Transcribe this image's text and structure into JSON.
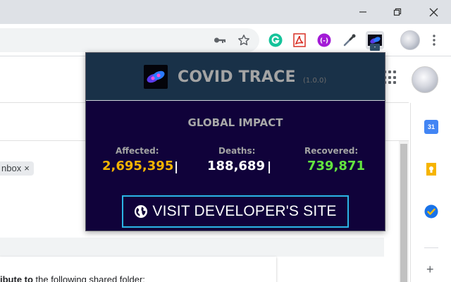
{
  "browser": {
    "extension_badge": "-"
  },
  "page": {
    "label_chip": "nbox",
    "label_chip_close": "×",
    "share_text_bold": "ibute to",
    "share_text_rest": " the following shared folder:",
    "calendar_day": "31"
  },
  "popup": {
    "title": "COVID TRACE",
    "version": "(1.0.0)",
    "section_title": "GLOBAL IMPACT",
    "stats": [
      {
        "label": "Affected:",
        "value": "2,695,395",
        "color": "#f4b400"
      },
      {
        "label": "Deaths:",
        "value": "188,689",
        "color": "#ffffff"
      },
      {
        "label": "Recovered:",
        "value": "739,871",
        "color": "#63e53f"
      }
    ],
    "separator": "|",
    "button_label": "VISIT DEVELOPER'S SITE"
  },
  "icons": [
    "minimize-icon",
    "maximize-icon",
    "close-icon",
    "key-icon",
    "star-icon",
    "grammarly-icon",
    "pdf-icon",
    "purple-extension-icon",
    "eyedropper-icon",
    "covid-trace-icon",
    "profile-avatar",
    "more-menu-icon",
    "apps-grid-icon",
    "calendar-icon",
    "keep-icon",
    "tasks-icon",
    "globe-icon"
  ]
}
